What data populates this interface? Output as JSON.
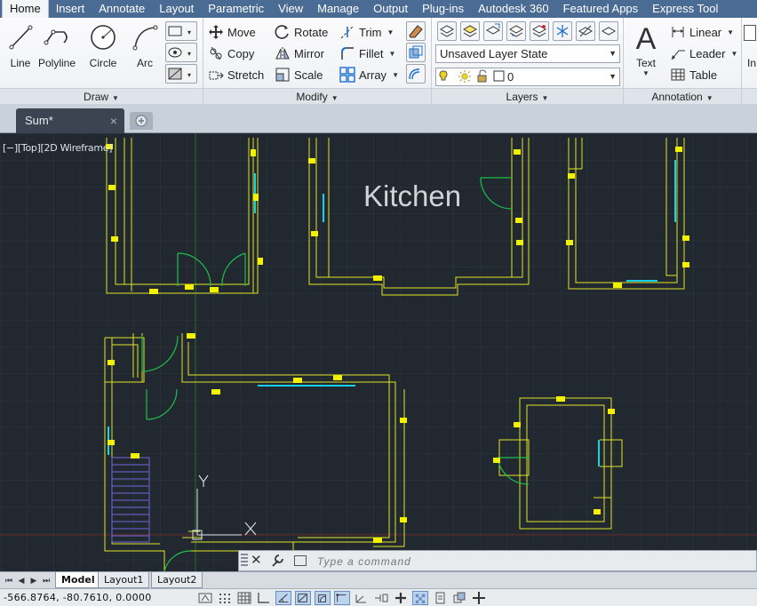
{
  "ribbon": {
    "tabs": [
      "Home",
      "Insert",
      "Annotate",
      "Layout",
      "Parametric",
      "View",
      "Manage",
      "Output",
      "Plug-ins",
      "Autodesk 360",
      "Featured Apps",
      "Express Tool"
    ],
    "active_tab": "Home",
    "draw": {
      "title": "Draw",
      "buttons": [
        "Line",
        "Polyline",
        "Circle",
        "Arc"
      ]
    },
    "modify": {
      "title": "Modify",
      "buttons": [
        "Move",
        "Rotate",
        "Trim",
        "Copy",
        "Mirror",
        "Fillet",
        "Stretch",
        "Scale",
        "Array"
      ]
    },
    "layers": {
      "title": "Layers",
      "layer_state": "Unsaved Layer State",
      "current_layer": "0"
    },
    "annotation": {
      "title": "Annotation",
      "text_label": "Text",
      "buttons": [
        "Linear",
        "Leader",
        "Table"
      ],
      "clipped": "In"
    }
  },
  "document": {
    "tab_name": "Sum*",
    "close_glyph": "×"
  },
  "viewport": {
    "label": "[−][Top][2D Wireframe]",
    "room_label": "Kitchen"
  },
  "command": {
    "placeholder": "Type a command",
    "close_glyph": "✕"
  },
  "layouts": {
    "tabs": [
      "Model",
      "Layout1",
      "Layout2"
    ],
    "active": "Model"
  },
  "status": {
    "coordinates": "-566.8764, -80.7610, 0.0000"
  },
  "colors": {
    "canvas_bg": "#212830",
    "wall": "#e3e326",
    "door": "#1fbf4a",
    "window": "#1ad0e8",
    "ribbon_tab_bg": "#4a6b93"
  }
}
